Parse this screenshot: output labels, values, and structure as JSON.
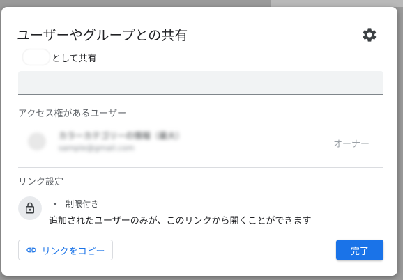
{
  "dialog": {
    "title": "ユーザーやグループとの共有",
    "settings_icon": "gear-icon",
    "share_as_suffix": "として共有"
  },
  "add_people_input": {
    "value": "",
    "placeholder": ""
  },
  "people_section": {
    "heading": "アクセス権があるユーザー",
    "users": [
      {
        "name": "カラーカテゴリーの情報（最大）",
        "email": "sample@gmail.com",
        "role": "オーナー"
      }
    ]
  },
  "link_section": {
    "heading": "リンク設定",
    "lock_icon": "lock-icon",
    "access_level": "制限付き",
    "access_description": "追加されたユーザーのみが、このリンクから開くことができます"
  },
  "buttons": {
    "copy_link": "リンクをコピー",
    "copy_link_icon": "link-icon",
    "done": "完了"
  },
  "colors": {
    "accent": "#1a73e8",
    "text_primary": "#202124",
    "text_secondary": "#5f6368",
    "input_bg": "#f1f3f4"
  }
}
